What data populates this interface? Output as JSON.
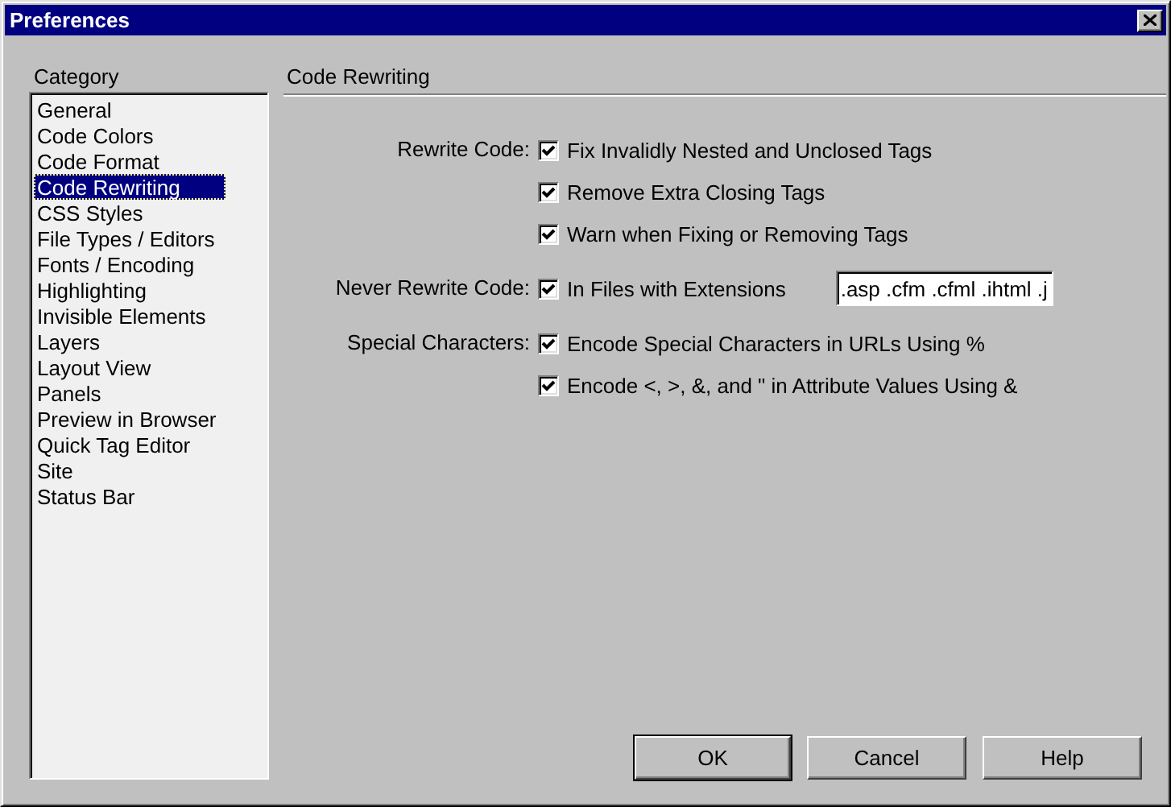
{
  "window": {
    "title": "Preferences"
  },
  "category_list": {
    "label": "Category",
    "items": [
      {
        "label": "General",
        "selected": false
      },
      {
        "label": "Code Colors",
        "selected": false
      },
      {
        "label": "Code Format",
        "selected": false
      },
      {
        "label": "Code Rewriting",
        "selected": true
      },
      {
        "label": "CSS Styles",
        "selected": false
      },
      {
        "label": "File Types / Editors",
        "selected": false
      },
      {
        "label": "Fonts / Encoding",
        "selected": false
      },
      {
        "label": "Highlighting",
        "selected": false
      },
      {
        "label": "Invisible Elements",
        "selected": false
      },
      {
        "label": "Layers",
        "selected": false
      },
      {
        "label": "Layout View",
        "selected": false
      },
      {
        "label": "Panels",
        "selected": false
      },
      {
        "label": "Preview in Browser",
        "selected": false
      },
      {
        "label": "Quick Tag Editor",
        "selected": false
      },
      {
        "label": "Site",
        "selected": false
      },
      {
        "label": "Status Bar",
        "selected": false
      }
    ]
  },
  "panel": {
    "title": "Code Rewriting",
    "groups": [
      {
        "label": "Rewrite Code:",
        "options": [
          {
            "label": "Fix Invalidly Nested and Unclosed Tags",
            "checked": true
          },
          {
            "label": "Remove Extra Closing Tags",
            "checked": true
          },
          {
            "label": "Warn when Fixing or Removing Tags",
            "checked": true
          }
        ]
      },
      {
        "label": "Never Rewrite Code:",
        "options": [
          {
            "label": "In Files with Extensions",
            "checked": true,
            "value": ".asp .cfm .cfml .ihtml .j"
          }
        ]
      },
      {
        "label": "Special Characters:",
        "options": [
          {
            "label": "Encode Special Characters in URLs Using %",
            "checked": true
          },
          {
            "label": "Encode <, >, &, and \" in Attribute Values Using &",
            "checked": true
          }
        ]
      }
    ]
  },
  "buttons": [
    {
      "label": "OK",
      "default": true
    },
    {
      "label": "Cancel",
      "default": false
    },
    {
      "label": "Help",
      "default": false
    }
  ]
}
